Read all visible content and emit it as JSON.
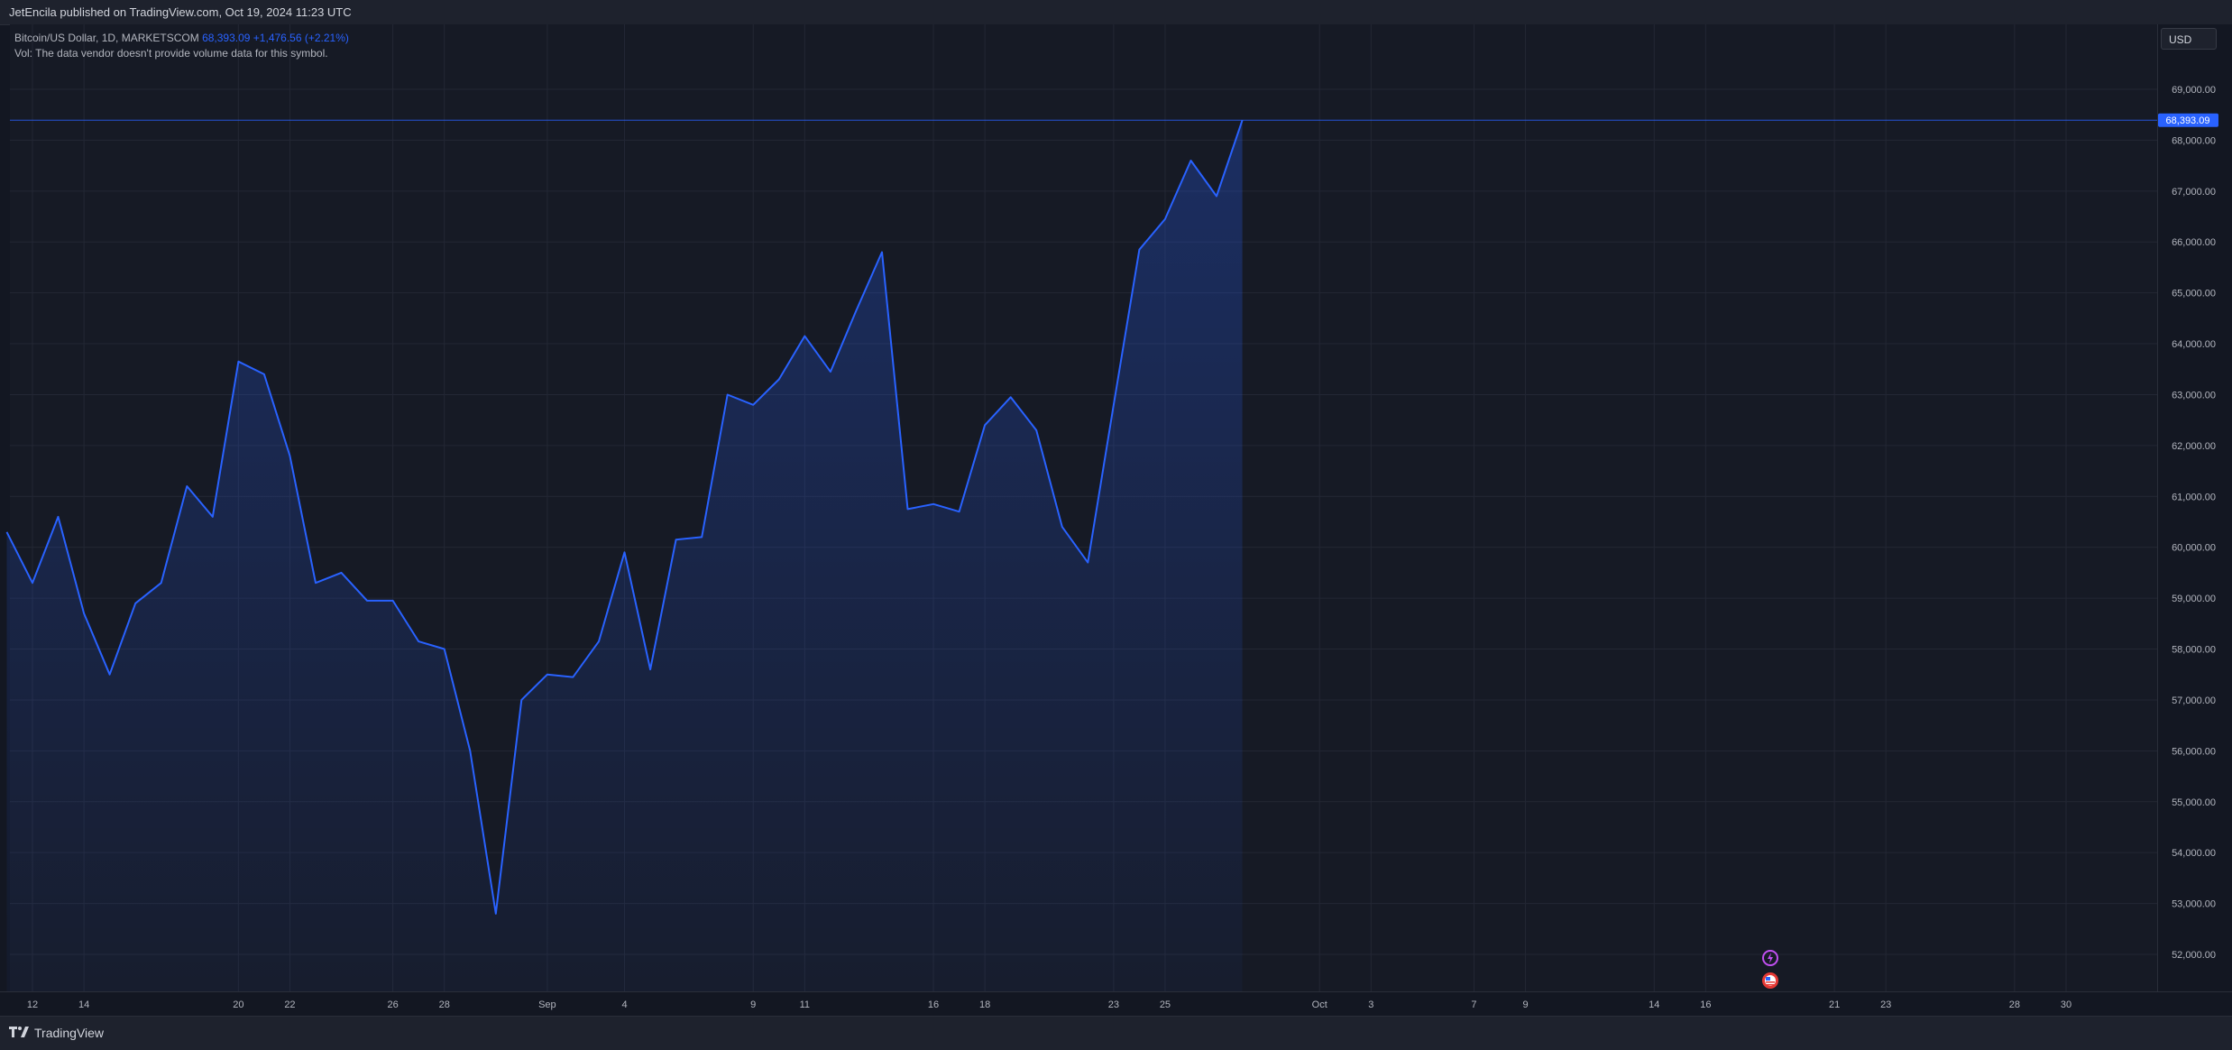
{
  "header": {
    "publish_info": "JetEncila published on TradingView.com, Oct 19, 2024 11:23 UTC"
  },
  "legend": {
    "symbol": "Bitcoin/US Dollar, 1D, MARKETSCOM",
    "last_value": "68,393.09",
    "change": "+1,476.56 (+2.21%)",
    "volume_note": "Vol: The data vendor doesn't provide volume data for this symbol."
  },
  "price_scale": {
    "currency": "USD",
    "last_price_label": "68,393.09"
  },
  "footer": {
    "brand": "TradingView"
  },
  "colors": {
    "line": "#2962ff",
    "badge": "#2962ff",
    "background": "#161a25",
    "grid": "#232734",
    "event_purple": "#c04ff0",
    "event_red": "#e53935"
  },
  "icons": {
    "event_top": "lightning-icon",
    "event_bottom": "us-flag-icon",
    "brand": "tradingview-logo-icon"
  },
  "chart_data": {
    "type": "area",
    "title": "",
    "xlabel": "",
    "ylabel": "",
    "ylim": [
      51300,
      70400
    ],
    "grid": true,
    "y_ticks": [
      52000,
      53000,
      54000,
      55000,
      56000,
      57000,
      58000,
      59000,
      60000,
      61000,
      62000,
      63000,
      64000,
      65000,
      66000,
      67000,
      68000,
      69000
    ],
    "x_ticks": [
      {
        "date": "2024-08-12",
        "label": "12"
      },
      {
        "date": "2024-08-14",
        "label": "14"
      },
      {
        "date": "2024-08-20",
        "label": "20"
      },
      {
        "date": "2024-08-22",
        "label": "22"
      },
      {
        "date": "2024-08-26",
        "label": "26"
      },
      {
        "date": "2024-08-28",
        "label": "28"
      },
      {
        "date": "2024-09-01",
        "label": "Sep"
      },
      {
        "date": "2024-09-04",
        "label": "4"
      },
      {
        "date": "2024-09-09",
        "label": "9"
      },
      {
        "date": "2024-09-11",
        "label": "11"
      },
      {
        "date": "2024-09-16",
        "label": "16"
      },
      {
        "date": "2024-09-18",
        "label": "18"
      },
      {
        "date": "2024-09-23",
        "label": "23"
      },
      {
        "date": "2024-09-25",
        "label": "25"
      },
      {
        "date": "2024-10-01",
        "label": "Oct"
      },
      {
        "date": "2024-10-03",
        "label": "3"
      },
      {
        "date": "2024-10-07",
        "label": "7"
      },
      {
        "date": "2024-10-09",
        "label": "9"
      },
      {
        "date": "2024-10-14",
        "label": "14"
      },
      {
        "date": "2024-10-16",
        "label": "16"
      },
      {
        "date": "2024-10-21",
        "label": "21"
      },
      {
        "date": "2024-10-23",
        "label": "23"
      },
      {
        "date": "2024-10-28",
        "label": "28"
      },
      {
        "date": "2024-10-30",
        "label": "30"
      }
    ],
    "series": [
      {
        "values": [
          {
            "x": "2024-08-11",
            "y": 60300
          },
          {
            "x": "2024-08-12",
            "y": 59300
          },
          {
            "x": "2024-08-13",
            "y": 60600
          },
          {
            "x": "2024-08-14",
            "y": 58700
          },
          {
            "x": "2024-08-15",
            "y": 57500
          },
          {
            "x": "2024-08-16",
            "y": 58900
          },
          {
            "x": "2024-08-17",
            "y": 59300
          },
          {
            "x": "2024-08-18",
            "y": 61200
          },
          {
            "x": "2024-08-19",
            "y": 60600
          },
          {
            "x": "2024-08-20",
            "y": 63650
          },
          {
            "x": "2024-08-21",
            "y": 63400
          },
          {
            "x": "2024-08-22",
            "y": 61800
          },
          {
            "x": "2024-08-23",
            "y": 59300
          },
          {
            "x": "2024-08-24",
            "y": 59500
          },
          {
            "x": "2024-08-25",
            "y": 58950
          },
          {
            "x": "2024-08-26",
            "y": 58950
          },
          {
            "x": "2024-08-27",
            "y": 58150
          },
          {
            "x": "2024-08-28",
            "y": 58000
          },
          {
            "x": "2024-08-29",
            "y": 56000
          },
          {
            "x": "2024-08-30",
            "y": 52800
          },
          {
            "x": "2024-08-31",
            "y": 57000
          },
          {
            "x": "2024-09-01",
            "y": 57500
          },
          {
            "x": "2024-09-02",
            "y": 57450
          },
          {
            "x": "2024-09-03",
            "y": 58150
          },
          {
            "x": "2024-09-04",
            "y": 59900
          },
          {
            "x": "2024-09-05",
            "y": 57600
          },
          {
            "x": "2024-09-06",
            "y": 60150
          },
          {
            "x": "2024-09-07",
            "y": 60200
          },
          {
            "x": "2024-09-08",
            "y": 63000
          },
          {
            "x": "2024-09-09",
            "y": 62800
          },
          {
            "x": "2024-09-10",
            "y": 63300
          },
          {
            "x": "2024-09-11",
            "y": 64150
          },
          {
            "x": "2024-09-12",
            "y": 63450
          },
          {
            "x": "2024-09-13",
            "y": 64650
          },
          {
            "x": "2024-09-14",
            "y": 65800
          },
          {
            "x": "2024-09-15",
            "y": 60750
          },
          {
            "x": "2024-09-16",
            "y": 60850
          },
          {
            "x": "2024-09-17",
            "y": 60700
          },
          {
            "x": "2024-09-18",
            "y": 62400
          },
          {
            "x": "2024-09-19",
            "y": 62950
          },
          {
            "x": "2024-09-20",
            "y": 62300
          },
          {
            "x": "2024-09-21",
            "y": 60400
          },
          {
            "x": "2024-09-22",
            "y": 59700
          },
          {
            "x": "2024-09-23",
            "y": 62800
          },
          {
            "x": "2024-09-24",
            "y": 65850
          },
          {
            "x": "2024-09-25",
            "y": 66450
          },
          {
            "x": "2024-09-26",
            "y": 67600
          },
          {
            "x": "2024-09-27",
            "y": 66900
          },
          {
            "x": "2024-09-28",
            "y": 68393.09
          }
        ]
      }
    ],
    "last_value": 68393.09
  }
}
